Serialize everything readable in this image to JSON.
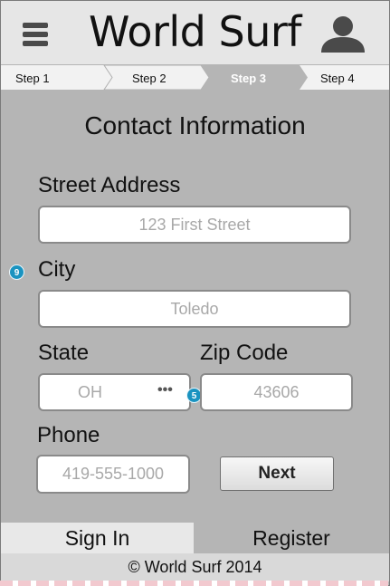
{
  "app": {
    "title": "World Surf"
  },
  "header": {
    "menu_icon": "hamburger-menu-icon",
    "profile_icon": "user-silhouette-icon"
  },
  "steps": [
    {
      "label": "Step 1",
      "state": "completed"
    },
    {
      "label": "Step 2",
      "state": "completed"
    },
    {
      "label": "Step 3",
      "state": "current"
    },
    {
      "label": "Step 4",
      "state": "upcoming"
    }
  ],
  "form": {
    "title": "Contact Information",
    "street": {
      "label": "Street Address",
      "placeholder": "123 First Street"
    },
    "city": {
      "label": "City",
      "placeholder": "Toledo",
      "badge": "9"
    },
    "state": {
      "label": "State",
      "value": "OH",
      "more": "•••"
    },
    "zip": {
      "label": "Zip Code",
      "placeholder": "43606",
      "badge": "5"
    },
    "phone": {
      "label": "Phone",
      "placeholder": "419-555-1000"
    },
    "next_label": "Next"
  },
  "footer": {
    "signin_label": "Sign In",
    "register_label": "Register",
    "copyright": "© World Surf 2014"
  },
  "colors": {
    "background": "#b5b5b5",
    "header": "#e6e6e6",
    "current_step": "#b5b5b5",
    "badge": "#1a93c0"
  }
}
